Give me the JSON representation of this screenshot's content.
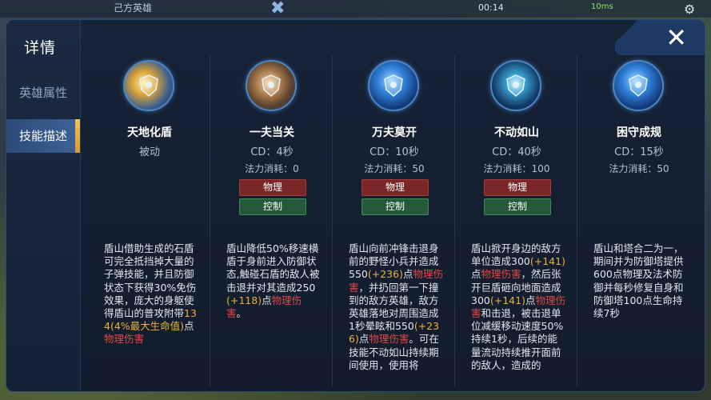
{
  "topbar": {
    "title": "己方英雄",
    "time": "00:14",
    "ping": "10ms"
  },
  "sidebar": {
    "title": "详情",
    "items": [
      {
        "label": "英雄属性",
        "active": false
      },
      {
        "label": "技能描述",
        "active": true
      }
    ]
  },
  "colors": {
    "physical_damage": "#e24a44",
    "scaling": "#e8b33a",
    "accent_gold": "#f0c25a"
  },
  "skills": [
    {
      "name": "天地化盾",
      "type": "被动",
      "icon": "gold-cannon-shield-icon",
      "desc": [
        {
          "t": "盾山借助生成的石盾可完全抵挡掉大量的子弹技能，并且防御状态下获得30%免伤效果，庞大的身躯使得盾山的普攻附带"
        },
        {
          "t": "134(4%最大生命值)",
          "c": "y"
        },
        {
          "t": "点"
        },
        {
          "t": "物理伤害",
          "c": "r"
        }
      ]
    },
    {
      "name": "一夫当关",
      "cd": "CD：4秒",
      "mana": "法力消耗：0",
      "tags": [
        "物理",
        "控制"
      ],
      "icon": "stone-shield-icon",
      "desc": [
        {
          "t": "盾山降低50%移速横盾于身前进入防御状态,触碰石盾的敌人被击退并对其造成250"
        },
        {
          "t": "(+118)",
          "c": "y"
        },
        {
          "t": "点"
        },
        {
          "t": "物理伤害",
          "c": "r"
        },
        {
          "t": "。"
        }
      ]
    },
    {
      "name": "万夫莫开",
      "cd": "CD：10秒",
      "mana": "法力消耗：50",
      "tags": [
        "物理",
        "控制"
      ],
      "icon": "charge-shield-icon",
      "desc": [
        {
          "t": "盾山向前冲锋击退身前的野怪小兵并造成550"
        },
        {
          "t": "(+236)",
          "c": "y"
        },
        {
          "t": "点"
        },
        {
          "t": "物理伤害",
          "c": "r"
        },
        {
          "t": "，并扔回第一下撞到的敌方英雄，敌方英雄落地对周围造成1秒晕眩和550"
        },
        {
          "t": "(+236)",
          "c": "y"
        },
        {
          "t": "点"
        },
        {
          "t": "物理伤害",
          "c": "r"
        },
        {
          "t": "。可在技能不动如山持续期间使用，使用将"
        }
      ]
    },
    {
      "name": "不动如山",
      "cd": "CD：40秒",
      "mana": "法力消耗：100",
      "tags": [
        "物理",
        "控制"
      ],
      "icon": "giant-shield-icon",
      "desc": [
        {
          "t": "盾山掀开身边的敌方单位造成300"
        },
        {
          "t": "(+141)",
          "c": "y"
        },
        {
          "t": "点"
        },
        {
          "t": "物理伤害",
          "c": "r"
        },
        {
          "t": "，然后张开巨盾砸向地面造成300"
        },
        {
          "t": "(+141)",
          "c": "y"
        },
        {
          "t": "点"
        },
        {
          "t": "物理伤害",
          "c": "r"
        },
        {
          "t": "和击退，被击退单位减缓移动速度50%持续1秒，后续的能量流动持续推开面前的敌人，造成的"
        }
      ]
    },
    {
      "name": "困守成规",
      "cd": "CD：15秒",
      "mana": "法力消耗：50",
      "icon": "fortress-guard-icon",
      "desc": [
        {
          "t": "盾山和塔合二为一，期间并为防御塔提供600点物理及法术防御并每秒修复自身和防御塔100点生命持续7秒"
        }
      ]
    }
  ]
}
